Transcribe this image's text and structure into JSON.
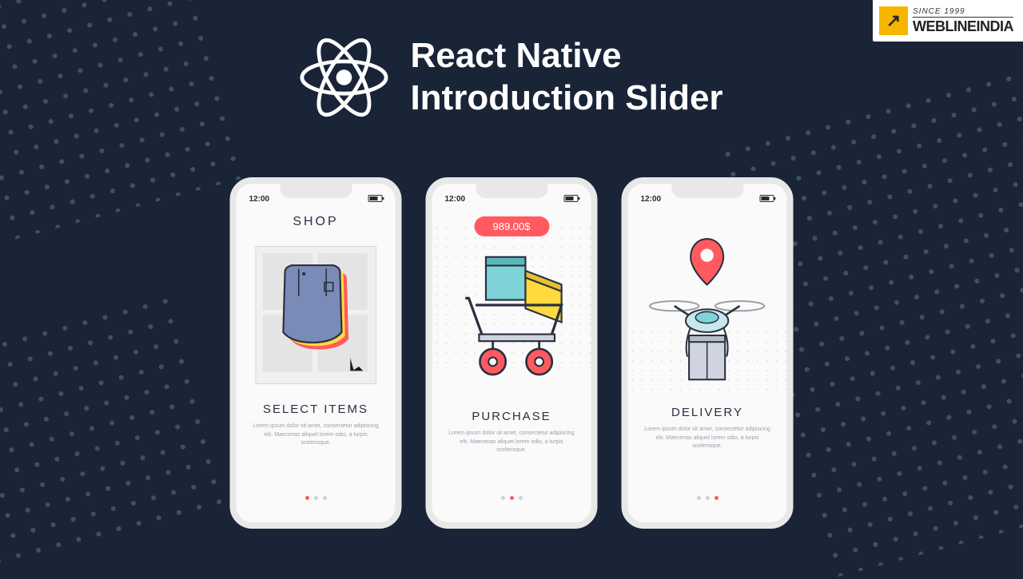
{
  "title_line1": "React Native",
  "title_line2": "Introduction Slider",
  "badge": {
    "since": "SINCE 1999",
    "company": "WEBLINEINDIA"
  },
  "phones": {
    "status_time": "12:00",
    "lorem": "Lorem ipsum dolor sit amet, consectetur adipiscing elit. Maecenas aliquet lorem odio, a turpis scelerisque.",
    "shop": {
      "top_label": "SHOP",
      "bottom_label": "SELECT ITEMS",
      "active_dot": 0
    },
    "purchase": {
      "price": "989.00$",
      "bottom_label": "PURCHASE",
      "active_dot": 1
    },
    "delivery": {
      "bottom_label": "DELIVERY",
      "active_dot": 2
    }
  },
  "colors": {
    "background": "#1a2437",
    "accent": "#ff5a5f",
    "phone_border": "#e8e8e8"
  }
}
